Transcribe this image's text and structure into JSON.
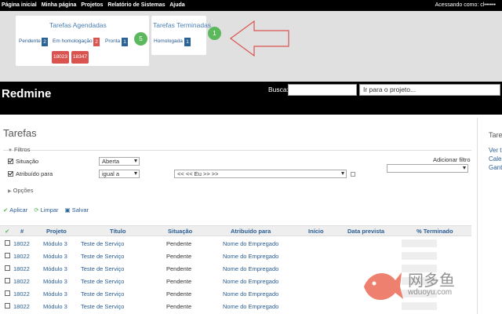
{
  "top_menu": {
    "items": [
      "Página inicial",
      "Minha página",
      "Projetos",
      "Relatório de Sistemas",
      "Ajuda"
    ],
    "account": "Acessando como: cl••••••"
  },
  "dashboard": {
    "scheduled": {
      "title": "Tarefas Agendadas",
      "pendente_label": "Pendente",
      "pendente_count": "2",
      "homolog_label": "Em homologação",
      "homolog_count": "2",
      "pronta_label": "Pronta",
      "pronta_count": "1",
      "ids": [
        "18023",
        "18347"
      ],
      "total": "5"
    },
    "finished": {
      "title": "Tarefas Terminadas",
      "homologada_label": "Homologada",
      "homologada_count": "1",
      "total": "1"
    }
  },
  "header": {
    "brand": "Redmine",
    "search_label": "Busca:",
    "project_jump": "Ir para o projeto..."
  },
  "page": {
    "title": "Tarefas",
    "filters_legend": "Filtros",
    "filter_situacao": "Situação",
    "filter_situacao_value": "Aberta",
    "filter_atribuido": "Atribuído para",
    "filter_atribuido_op": "igual a",
    "filter_atribuido_value": "<< << Eu >> >>",
    "add_filter_label": "Adicionar filtro",
    "options_legend": "Opções",
    "apply": "Aplicar",
    "clear": "Limpar",
    "save": "Salvar"
  },
  "table": {
    "headers": {
      "num": "#",
      "projeto": "Projeto",
      "titulo": "Título",
      "situacao": "Situação",
      "atribuido": "Atribuído para",
      "inicio": "Início",
      "data_prevista": "Data prevista",
      "pct": "% Terminado"
    },
    "rows": [
      {
        "id": "18022",
        "projeto": "Módulo 3",
        "titulo": "Teste de Serviço",
        "situacao": "Pendente",
        "atribuido": "Nome do Empregado",
        "pct_done": 0
      },
      {
        "id": "18022",
        "projeto": "Módulo 3",
        "titulo": "Teste de Serviço",
        "situacao": "Pendente",
        "atribuido": "Nome do Empregado",
        "pct_done": 0
      },
      {
        "id": "18022",
        "projeto": "Módulo 3",
        "titulo": "Teste de Serviço",
        "situacao": "Pendente",
        "atribuido": "Nome do Empregado",
        "pct_done": 0
      },
      {
        "id": "18022",
        "projeto": "Módulo 3",
        "titulo": "Teste de Serviço",
        "situacao": "Pendente",
        "atribuido": "Nome do Empregado",
        "pct_done": 0
      },
      {
        "id": "18022",
        "projeto": "Módulo 3",
        "titulo": "Teste de Serviço",
        "situacao": "Pendente",
        "atribuido": "Nome do Empregado",
        "pct_done": 0
      },
      {
        "id": "18022",
        "projeto": "Módulo 3",
        "titulo": "Teste de Serviço",
        "situacao": "Pendente",
        "atribuido": "Nome do Empregado",
        "pct_done": 0
      }
    ]
  },
  "sidebar": {
    "title": "Tare",
    "links": [
      "Ver t",
      "Caler",
      "Gant"
    ]
  },
  "watermark": {
    "cn": "网多鱼",
    "url": "wduoyu.com"
  },
  "colors": {
    "link": "#2a5d94",
    "badge_red": "#d9534f",
    "badge_blue": "#2a6496",
    "circle_green": "#5cb85c"
  }
}
